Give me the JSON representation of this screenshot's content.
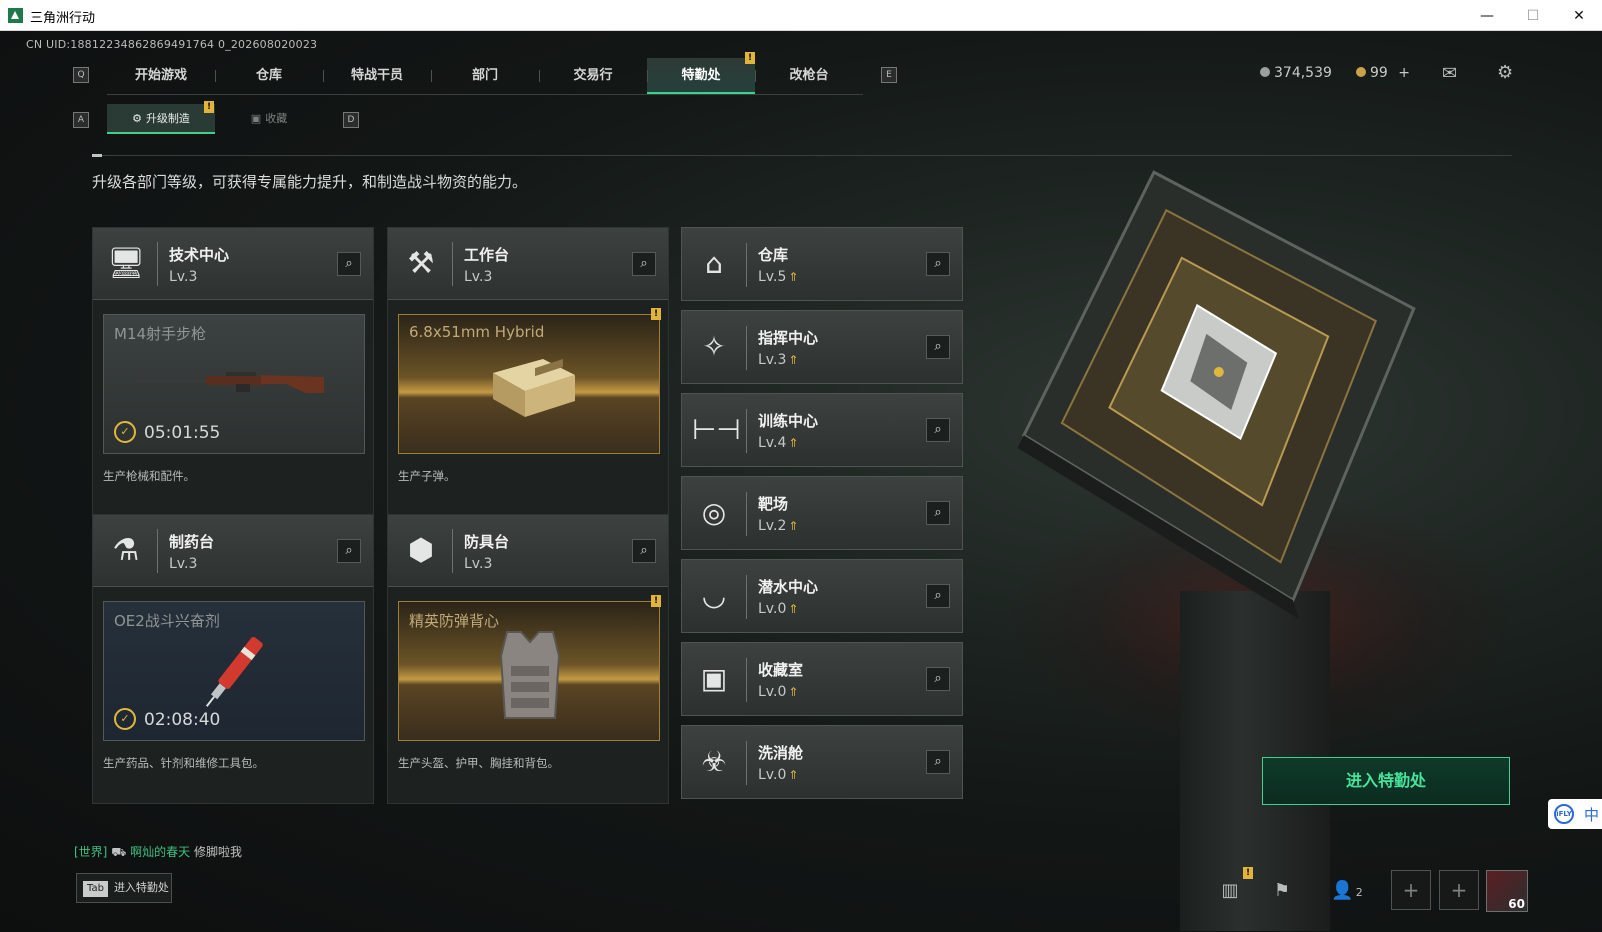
{
  "window": {
    "title": "三角洲行动",
    "min": "—",
    "max": "☐",
    "close": "✕"
  },
  "uid": "CN UID:18812234862869491764 0_202608020023",
  "top_nav": {
    "key_left": "Q",
    "key_right": "E",
    "tabs": [
      "开始游戏",
      "仓库",
      "特战干员",
      "部门",
      "交易行",
      "特勤处",
      "改枪台"
    ],
    "active": "特勤处"
  },
  "alert_mark": "!",
  "currency": {
    "coins": "374,539",
    "premium": "99",
    "add": "+"
  },
  "sub_nav": {
    "key_left": "A",
    "key_right": "D",
    "tabs": [
      "升级制造",
      "收藏"
    ],
    "active": "升级制造"
  },
  "description": "升级各部门等级，可获得专属能力提升，和制造战斗物资的能力。",
  "production_cards": [
    {
      "name": "技术中心",
      "level": "Lv.3",
      "product": "M14射手步枪",
      "timer": "05:01:55",
      "desc": "生产枪械和配件。",
      "style": "steel",
      "alert": false
    },
    {
      "name": "工作台",
      "level": "Lv.3",
      "product": "6.8x51mm Hybrid",
      "timer": "",
      "desc": "生产子弹。",
      "style": "gold",
      "alert": true
    },
    {
      "name": "制药台",
      "level": "Lv.3",
      "product": "OE2战斗兴奋剂",
      "timer": "02:08:40",
      "desc": "生产药品、针剂和维修工具包。",
      "style": "navy",
      "alert": false
    },
    {
      "name": "防具台",
      "level": "Lv.3",
      "product": "精英防弹背心",
      "timer": "",
      "desc": "生产头盔、护甲、胸挂和背包。",
      "style": "gold",
      "alert": true
    }
  ],
  "facilities": [
    {
      "name": "仓库",
      "level": "Lv.5",
      "icon": "warehouse-icon"
    },
    {
      "name": "指挥中心",
      "level": "Lv.3",
      "icon": "command-icon"
    },
    {
      "name": "训练中心",
      "level": "Lv.4",
      "icon": "dumbbell-icon"
    },
    {
      "name": "靶场",
      "level": "Lv.2",
      "icon": "target-icon"
    },
    {
      "name": "潜水中心",
      "level": "Lv.0",
      "icon": "diving-mask-icon"
    },
    {
      "name": "收藏室",
      "level": "Lv.0",
      "icon": "collection-icon"
    },
    {
      "name": "洗消舱",
      "level": "Lv.0",
      "icon": "decon-icon"
    }
  ],
  "cta": "进入特勤处",
  "chat": {
    "channel": "[世界]",
    "user": "啊灿的春天",
    "message": "修脚啦我"
  },
  "tab_hint": {
    "key": "Tab",
    "label": "进入特勤处"
  },
  "bottom": {
    "friends": "2",
    "level": "60"
  },
  "ime": {
    "brand": "iFLY",
    "lang": "中"
  },
  "colors": {
    "accent": "#3fd08a",
    "gold": "#e0b63f",
    "bg": "#121615"
  }
}
